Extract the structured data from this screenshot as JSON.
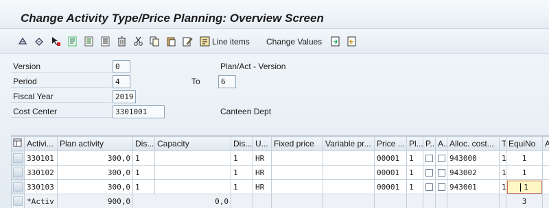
{
  "window": {
    "title": "Change Activity Type/Price Planning: Overview Screen"
  },
  "toolbar": {
    "icons": [
      "overview-icon",
      "change-icon",
      "select-icon",
      "save-icon",
      "previous-icon",
      "next-icon",
      "delete-icon",
      "cut-icon",
      "copy-icon",
      "paste-icon",
      "edit-icon",
      "line-items-icon",
      "export-icon",
      "import-icon"
    ],
    "line_items_label": "Line items",
    "change_values_label": "Change Values"
  },
  "form": {
    "version_label": "Version",
    "version_value": "0",
    "version_desc": "Plan/Act - Version",
    "period_label": "Period",
    "period_from": "4",
    "period_to_label": "To",
    "period_to": "6",
    "fiscal_year_label": "Fiscal Year",
    "fiscal_year_value": "2019",
    "cost_center_label": "Cost Center",
    "cost_center_value": "3301001",
    "cost_center_desc": "Canteen Dept"
  },
  "grid": {
    "columns": [
      "Activi...",
      "Plan activity",
      "Dis...",
      "Capacity",
      "Dis...",
      "U...",
      "Fixed price",
      "Variable pr...",
      "Price ...",
      "Pl...",
      "P...",
      "A...",
      "Alloc. cost...",
      "T",
      "EquiNo",
      "A"
    ],
    "rows": [
      {
        "activity": "330101",
        "plan_activity": "300,0",
        "dist": "1",
        "capacity": "",
        "dist2": "1",
        "unit": "HR",
        "fixed_price": "",
        "variable_price": "",
        "price_unit": "00001",
        "plan_ind": "1",
        "alloc_cost": "943000",
        "t": "1",
        "equino": "1"
      },
      {
        "activity": "330102",
        "plan_activity": "300,0",
        "dist": "1",
        "capacity": "",
        "dist2": "1",
        "unit": "HR",
        "fixed_price": "",
        "variable_price": "",
        "price_unit": "00001",
        "plan_ind": "1",
        "alloc_cost": "943002",
        "t": "1",
        "equino": "1"
      },
      {
        "activity": "330103",
        "plan_activity": "300,0",
        "dist": "1",
        "capacity": "",
        "dist2": "1",
        "unit": "HR",
        "fixed_price": "",
        "variable_price": "",
        "price_unit": "00001",
        "plan_ind": "1",
        "alloc_cost": "943001",
        "t": "1",
        "equino": "1"
      }
    ],
    "summary": {
      "activity": "*Activ",
      "plan_activity": "900,0",
      "capacity": "0,0",
      "equino": "3"
    }
  }
}
